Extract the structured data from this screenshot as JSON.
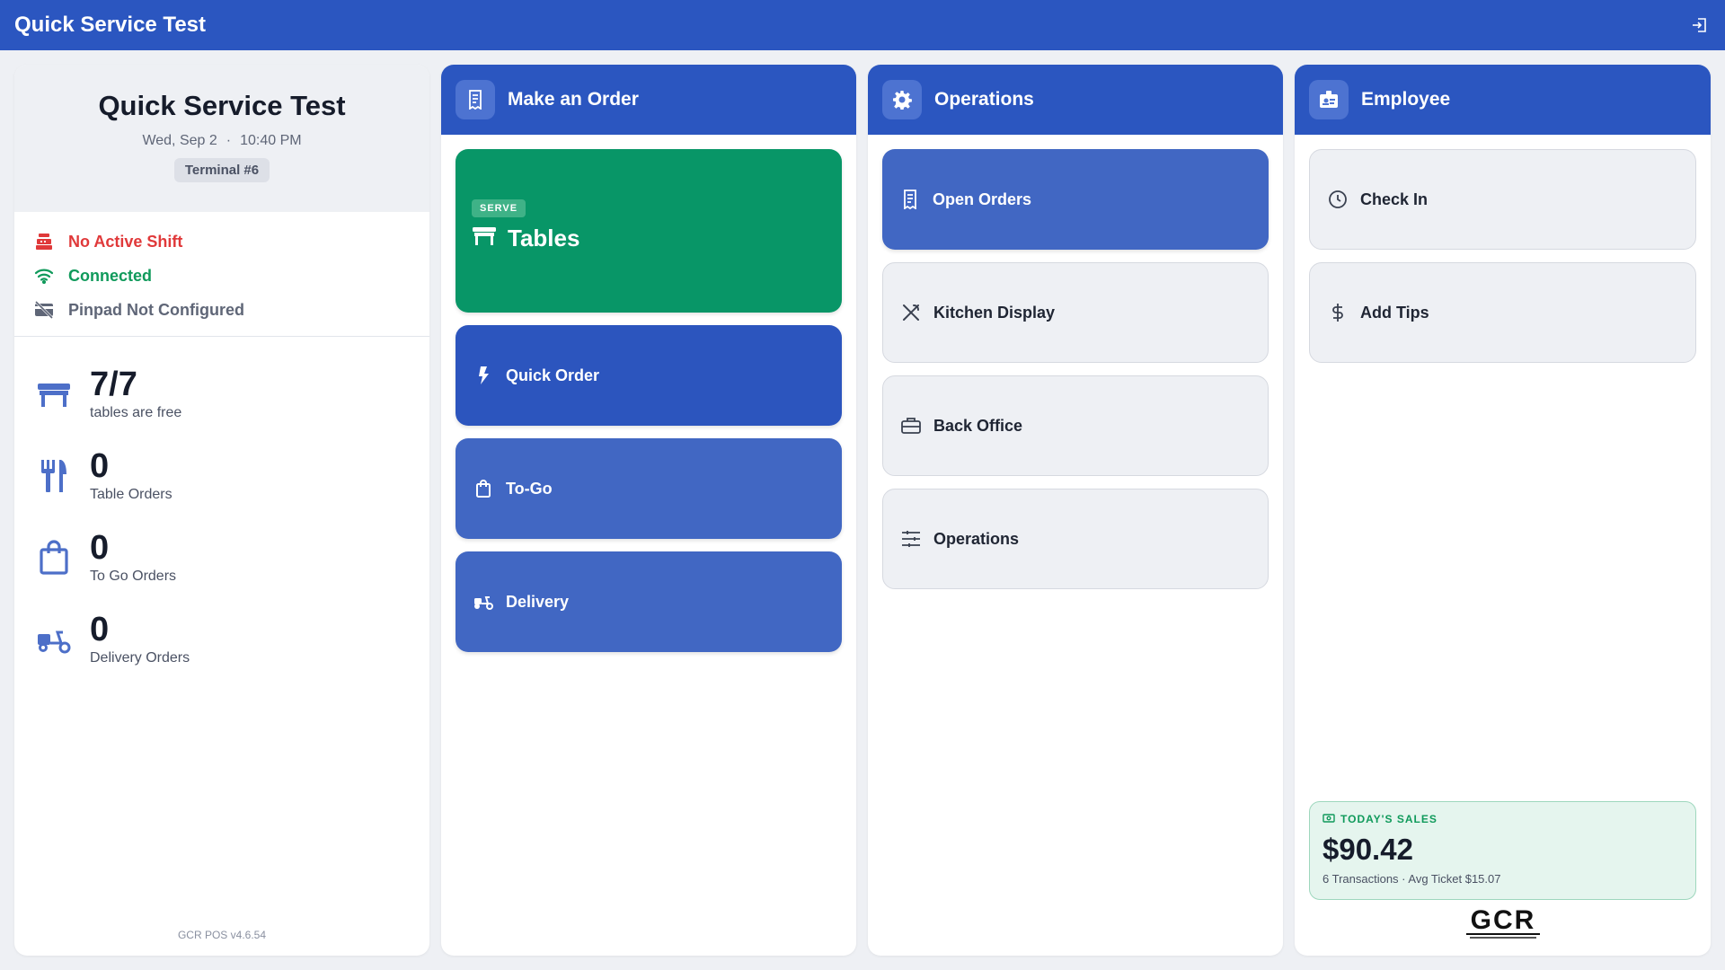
{
  "topbar": {
    "title": "Quick Service Test",
    "exit_icon": "logout-icon"
  },
  "status": {
    "store_name": "Quick Service Test",
    "date": "Wed, Sep 2",
    "separator": "·",
    "time": "10:40 PM",
    "terminal": "Terminal #6",
    "indicators": [
      {
        "label": "No Active Shift",
        "icon": "register-icon",
        "color": "#e0393a"
      },
      {
        "label": "Connected",
        "icon": "wifi-icon",
        "color": "#109a5b"
      },
      {
        "label": "Pinpad Not Configured",
        "icon": "card-off-icon",
        "color": "#5f6677"
      }
    ],
    "stats": [
      {
        "value": "7/7",
        "label": "tables are free",
        "icon": "table-icon"
      },
      {
        "value": "0",
        "label": "Table Orders",
        "icon": "utensils-icon"
      },
      {
        "value": "0",
        "label": "To Go Orders",
        "icon": "bag-icon"
      },
      {
        "value": "0",
        "label": "Delivery Orders",
        "icon": "scooter-icon"
      }
    ],
    "version": "GCR POS v4.6.54"
  },
  "order": {
    "title": "Make an Order",
    "tables_badge": "SERVE",
    "tables_label": "Tables",
    "tiles": [
      {
        "label": "Quick Order",
        "icon": "bolt-icon"
      },
      {
        "label": "To-Go",
        "icon": "bag-icon"
      },
      {
        "label": "Delivery",
        "icon": "scooter-icon"
      }
    ]
  },
  "ops": {
    "title": "Operations",
    "tiles": [
      {
        "label": "Open Orders",
        "icon": "receipt-icon"
      },
      {
        "label": "Kitchen Display",
        "icon": "utensils-cross-icon"
      },
      {
        "label": "Back Office",
        "icon": "briefcase-icon"
      },
      {
        "label": "Operations",
        "icon": "sliders-icon"
      }
    ]
  },
  "employee": {
    "title": "Employee",
    "tiles": [
      {
        "label": "Check In",
        "icon": "clock-icon"
      },
      {
        "label": "Add Tips",
        "icon": "dollar-icon"
      }
    ],
    "sales": {
      "heading": "TODAY'S SALES",
      "amount": "$90.42",
      "summary": "6 Transactions · Avg Ticket $15.07"
    },
    "logo_text": "GCR"
  },
  "colors": {
    "primary": "#2b56c0",
    "primary_mid": "#4167c3",
    "green": "#089667",
    "red": "#e0393a"
  }
}
